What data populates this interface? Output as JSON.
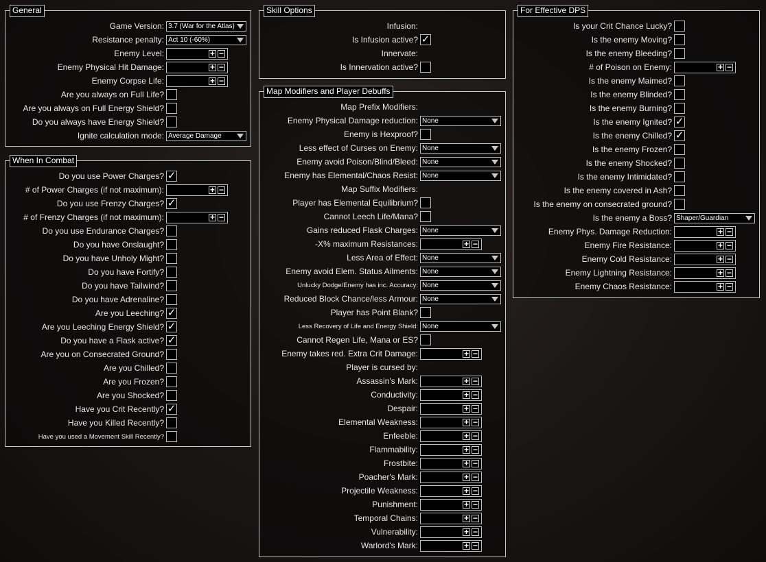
{
  "general": {
    "title": "General",
    "rows": [
      {
        "label": "Game Version:",
        "type": "dropdown",
        "value": "3.7 (War for the Atlas)",
        "w": 117
      },
      {
        "label": "Resistance penalty:",
        "type": "dropdown",
        "value": "Act 10 (-60%)",
        "w": 117
      },
      {
        "label": "Enemy Level:",
        "type": "number"
      },
      {
        "label": "Enemy Physical Hit Damage:",
        "type": "number"
      },
      {
        "label": "Enemy Corpse Life:",
        "type": "number"
      },
      {
        "label": "Are you always on Full Life?",
        "type": "checkbox",
        "checked": false
      },
      {
        "label": "Are you always on Full Energy Shield?",
        "type": "checkbox",
        "checked": false
      },
      {
        "label": "Do you always have Energy Shield?",
        "type": "checkbox",
        "checked": false
      },
      {
        "label": "Ignite calculation mode:",
        "type": "dropdown",
        "value": "Average Damage",
        "w": 117
      }
    ]
  },
  "combat": {
    "title": "When In Combat",
    "rows": [
      {
        "label": "Do you use Power Charges?",
        "type": "checkbox",
        "checked": true
      },
      {
        "label": "# of Power Charges (if not maximum):",
        "type": "number"
      },
      {
        "label": "Do you use Frenzy Charges?",
        "type": "checkbox",
        "checked": true
      },
      {
        "label": "# of Frenzy Charges (if not maximum):",
        "type": "number"
      },
      {
        "label": "Do you use Endurance Charges?",
        "type": "checkbox",
        "checked": false
      },
      {
        "label": "Do you have Onslaught?",
        "type": "checkbox",
        "checked": false
      },
      {
        "label": "Do you have Unholy Might?",
        "type": "checkbox",
        "checked": false
      },
      {
        "label": "Do you have Fortify?",
        "type": "checkbox",
        "checked": false
      },
      {
        "label": "Do you have Tailwind?",
        "type": "checkbox",
        "checked": false
      },
      {
        "label": "Do you have Adrenaline?",
        "type": "checkbox",
        "checked": false
      },
      {
        "label": "Are you Leeching?",
        "type": "checkbox",
        "checked": true
      },
      {
        "label": "Are you Leeching Energy Shield?",
        "type": "checkbox",
        "checked": true
      },
      {
        "label": "Do you have a Flask active?",
        "type": "checkbox",
        "checked": true
      },
      {
        "label": "Are you on Consecrated Ground?",
        "type": "checkbox",
        "checked": false
      },
      {
        "label": "Are you Chilled?",
        "type": "checkbox",
        "checked": false
      },
      {
        "label": "Are you Frozen?",
        "type": "checkbox",
        "checked": false
      },
      {
        "label": "Are you Shocked?",
        "type": "checkbox",
        "checked": false
      },
      {
        "label": "Have you Crit Recently?",
        "type": "checkbox",
        "checked": true
      },
      {
        "label": "Have you Killed Recently?",
        "type": "checkbox",
        "checked": false
      },
      {
        "label": "Have you used a Movement Skill Recently?",
        "type": "checkbox",
        "checked": false,
        "small": true
      }
    ]
  },
  "skill": {
    "title": "Skill Options",
    "rows": [
      {
        "label": "Infusion:",
        "type": "text"
      },
      {
        "label": "Is Infusion active?",
        "type": "checkbox",
        "checked": true
      },
      {
        "label": "Innervate:",
        "type": "text"
      },
      {
        "label": "Is Innervation active?",
        "type": "checkbox",
        "checked": false
      }
    ]
  },
  "map": {
    "title": "Map Modifiers and Player Debuffs",
    "rows": [
      {
        "label": "Map Prefix Modifiers:",
        "type": "text"
      },
      {
        "label": "Enemy Physical Damage reduction:",
        "type": "dropdown",
        "value": "None",
        "w": 118
      },
      {
        "label": "Enemy is Hexproof?",
        "type": "checkbox",
        "checked": false
      },
      {
        "label": "Less effect of Curses on Enemy:",
        "type": "dropdown",
        "value": "None",
        "w": 118
      },
      {
        "label": "Enemy avoid Poison/Blind/Bleed:",
        "type": "dropdown",
        "value": "None",
        "w": 118
      },
      {
        "label": "Enemy has Elemental/Chaos Resist:",
        "type": "dropdown",
        "value": "None",
        "w": 118
      },
      {
        "label": "Map Suffix Modifiers:",
        "type": "text"
      },
      {
        "label": "Player has Elemental Equilibrium?",
        "type": "checkbox",
        "checked": false
      },
      {
        "label": "Cannot Leech Life/Mana?",
        "type": "checkbox",
        "checked": false
      },
      {
        "label": "Gains reduced Flask Charges:",
        "type": "dropdown",
        "value": "None",
        "w": 118
      },
      {
        "label": "-X% maximum Resistances:",
        "type": "number"
      },
      {
        "label": "Less Area of Effect:",
        "type": "dropdown",
        "value": "None",
        "w": 118
      },
      {
        "label": "Enemy avoid Elem. Status Ailments:",
        "type": "dropdown",
        "value": "None",
        "w": 118
      },
      {
        "label": "Unlucky Dodge/Enemy has inc. Accuracy:",
        "type": "dropdown",
        "value": "None",
        "w": 118,
        "small": true
      },
      {
        "label": "Reduced Block Chance/less Armour:",
        "type": "dropdown",
        "value": "None",
        "w": 118
      },
      {
        "label": "Player has Point Blank?",
        "type": "checkbox",
        "checked": false
      },
      {
        "label": "Less Recovery of Life and Energy Shield:",
        "type": "dropdown",
        "value": "None",
        "w": 118,
        "small": true
      },
      {
        "label": "Cannot Regen Life, Mana or ES?",
        "type": "checkbox",
        "checked": false
      },
      {
        "label": "Enemy takes red. Extra Crit Damage:",
        "type": "number"
      },
      {
        "label": "Player is cursed by:",
        "type": "text"
      },
      {
        "label": "Assassin's Mark:",
        "type": "number"
      },
      {
        "label": "Conductivity:",
        "type": "number"
      },
      {
        "label": "Despair:",
        "type": "number"
      },
      {
        "label": "Elemental Weakness:",
        "type": "number"
      },
      {
        "label": "Enfeeble:",
        "type": "number"
      },
      {
        "label": "Flammability:",
        "type": "number"
      },
      {
        "label": "Frostbite:",
        "type": "number"
      },
      {
        "label": "Poacher's Mark:",
        "type": "number"
      },
      {
        "label": "Projectile Weakness:",
        "type": "number"
      },
      {
        "label": "Punishment:",
        "type": "number"
      },
      {
        "label": "Temporal Chains:",
        "type": "number"
      },
      {
        "label": "Vulnerability:",
        "type": "number"
      },
      {
        "label": "Warlord's Mark:",
        "type": "number"
      }
    ]
  },
  "dps": {
    "title": "For Effective DPS",
    "rows": [
      {
        "label": "Is your Crit Chance Lucky?",
        "type": "checkbox",
        "checked": false
      },
      {
        "label": "Is the enemy Moving?",
        "type": "checkbox",
        "checked": false
      },
      {
        "label": "Is the enemy Bleeding?",
        "type": "checkbox",
        "checked": false
      },
      {
        "label": "# of Poison on Enemy:",
        "type": "number"
      },
      {
        "label": "Is the enemy Maimed?",
        "type": "checkbox",
        "checked": false
      },
      {
        "label": "Is the enemy Blinded?",
        "type": "checkbox",
        "checked": false
      },
      {
        "label": "Is the enemy Burning?",
        "type": "checkbox",
        "checked": false
      },
      {
        "label": "Is the enemy Ignited?",
        "type": "checkbox",
        "checked": true
      },
      {
        "label": "Is the enemy Chilled?",
        "type": "checkbox",
        "checked": true
      },
      {
        "label": "Is the enemy Frozen?",
        "type": "checkbox",
        "checked": false
      },
      {
        "label": "Is the enemy Shocked?",
        "type": "checkbox",
        "checked": false
      },
      {
        "label": "Is the enemy Intimidated?",
        "type": "checkbox",
        "checked": false
      },
      {
        "label": "Is the enemy covered in Ash?",
        "type": "checkbox",
        "checked": false
      },
      {
        "label": "Is the enemy on consecrated ground?",
        "type": "checkbox",
        "checked": false
      },
      {
        "label": "Is the enemy a Boss?",
        "type": "dropdown",
        "value": "Shaper/Guardian",
        "w": 118
      },
      {
        "label": "Enemy Phys. Damage Reduction:",
        "type": "number"
      },
      {
        "label": "Enemy Fire Resistance:",
        "type": "number"
      },
      {
        "label": "Enemy Cold Resistance:",
        "type": "number"
      },
      {
        "label": "Enemy Lightning Resistance:",
        "type": "number"
      },
      {
        "label": "Enemy Chaos Resistance:",
        "type": "number"
      }
    ]
  },
  "icons": {
    "check": "✓",
    "plus": "+",
    "minus": "−"
  }
}
